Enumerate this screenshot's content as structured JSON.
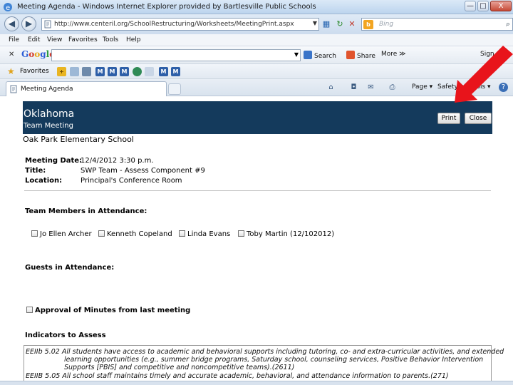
{
  "window": {
    "title": "Meeting Agenda - Windows Internet Explorer provided by Bartlesville Public Schools",
    "min_glyph": "—",
    "max_glyph": "□",
    "close_glyph": "X"
  },
  "address": {
    "url": "http://www.centeril.org/SchoolRestructuring/Worksheets/MeetingPrint.aspx",
    "search_placeholder": "Bing",
    "back_glyph": "◀",
    "forward_glyph": "▶"
  },
  "menu": [
    "File",
    "Edit",
    "View",
    "Favorites",
    "Tools",
    "Help"
  ],
  "google_toolbar": {
    "logo_letters": [
      "G",
      "o",
      "o",
      "g",
      "l",
      "e"
    ],
    "search_label": "Search",
    "share_label": "Share",
    "more_label": "More ≫",
    "signin_label": "Sign"
  },
  "favorites_bar": {
    "label": "Favorites",
    "m_letter": "M"
  },
  "tab": {
    "label": "Meeting Agenda"
  },
  "command_bar": {
    "page_label": "Page ▾",
    "safety_label": "Safety ▾",
    "tools_label": "Tools ▾",
    "help_glyph": "?"
  },
  "page": {
    "state": "Oklahoma",
    "subtitle": "Team Meeting",
    "print_label": "Print",
    "close_label": "Close",
    "school": "Oak Park Elementary School",
    "meeting_info": [
      {
        "label": "Meeting Date:",
        "value": "12/4/2012   3:30 p.m."
      },
      {
        "label": "Title:",
        "value": "SWP Team - Assess Component #9"
      },
      {
        "label": "Location:",
        "value": "Principal's Conference Room"
      }
    ],
    "members_heading": "Team Members in Attendance:",
    "members": [
      "Jo Ellen Archer",
      "Kenneth Copeland",
      "Linda Evans",
      "Toby Martin (12/102012)"
    ],
    "guests_heading": "Guests in Attendance:",
    "approval_label": "Approval of Minutes from last meeting",
    "indicators_heading": "Indicators to Assess",
    "indicators": [
      "EEIIb 5.02 All students have access to academic and behavioral supports including tutoring, co- and extra-curricular activities, and extended",
      "learning opportunities (e.g., summer bridge programs, Saturday school, counseling services, Positive Behavior Intervention",
      "Supports [PBIS] and competitive and noncompetitive teams).(2611)",
      "EEIIB 5.05 All school staff maintains timely and accurate academic, behavioral, and attendance information to parents.(271)"
    ]
  },
  "colors": {
    "header_band": "#143a5c",
    "arrow": "#e8141b"
  }
}
